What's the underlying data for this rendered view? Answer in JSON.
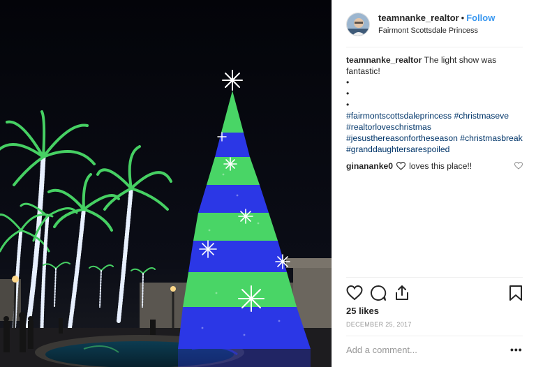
{
  "post": {
    "username": "teamnanke_realtor",
    "separator": "•",
    "follow_label": "Follow",
    "location": "Fairmont Scottsdale Princess",
    "icons": {
      "like": "heart-outline-icon",
      "comment": "comment-bubble-icon",
      "share": "share-icon",
      "save": "bookmark-icon",
      "more": "ellipsis-icon"
    }
  },
  "caption": {
    "username": "teamnanke_realtor",
    "text": "The light show was fantastic!",
    "bullets": [
      "•",
      "•",
      "•"
    ],
    "hashtags": "#fairmontscottsdaleprincess #christmaseve #realtorloveschristmas #jesusthereasonfortheseason #christmasbreak #granddaughtersarespoiled"
  },
  "reply": {
    "username": "ginananke0",
    "text": "loves this place!!"
  },
  "stats": {
    "likes": "25 likes",
    "date": "DECEMBER 25, 2017"
  },
  "comment_box": {
    "placeholder": "Add a comment...",
    "more_label": "•••"
  },
  "colors": {
    "follow": "#3897f0",
    "hashtag": "#003569",
    "tree_green": "#4ee06a",
    "tree_blue": "#2a35e8"
  }
}
